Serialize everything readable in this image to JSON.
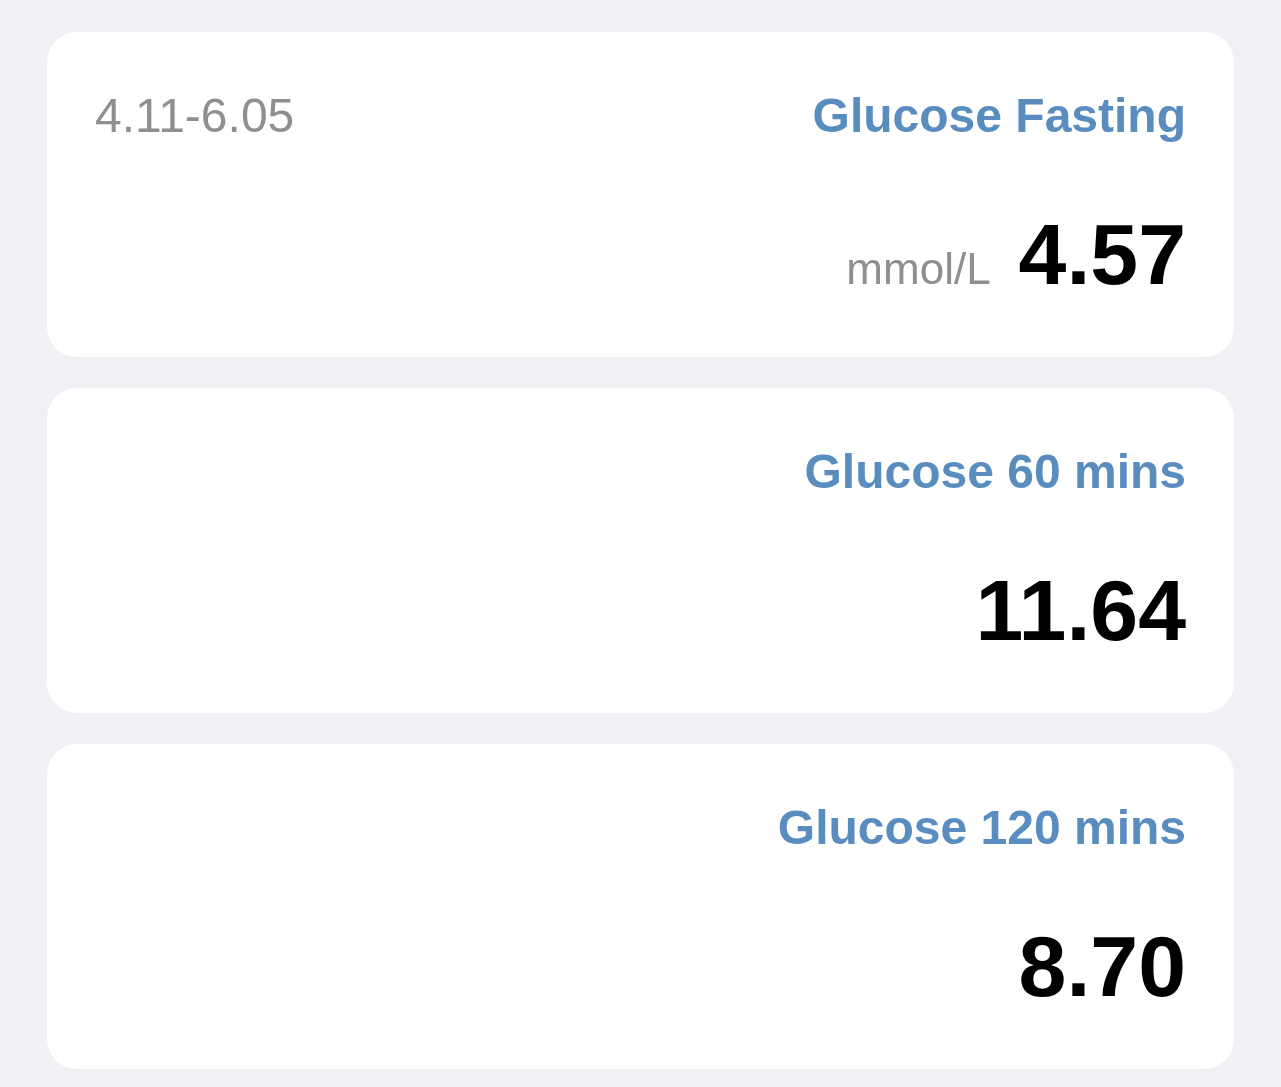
{
  "cards": [
    {
      "range": "4.11-6.05",
      "title": "Glucose Fasting",
      "unit": "mmol/L",
      "value": "4.57"
    },
    {
      "title": "Glucose 60 mins",
      "value": "11.64"
    },
    {
      "title": "Glucose 120 mins",
      "value": "8.70"
    }
  ]
}
